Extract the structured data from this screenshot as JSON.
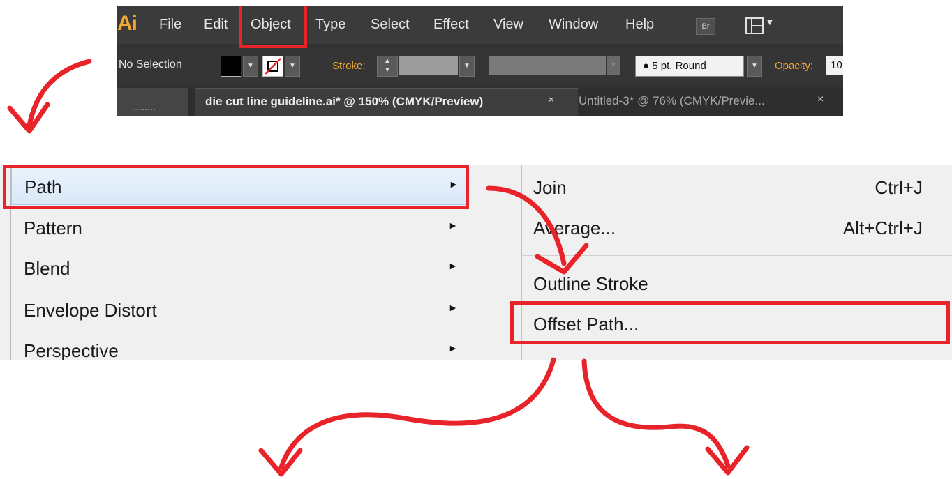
{
  "app": {
    "logo": "Ai",
    "menu": [
      "File",
      "Edit",
      "Object",
      "Type",
      "Select",
      "Effect",
      "View",
      "Window",
      "Help"
    ],
    "bridge_icon_label": "Br"
  },
  "control_bar": {
    "selection_status": "No Selection",
    "stroke_label": "Stroke:",
    "brush_value": "●  5 pt. Round",
    "opacity_label": "Opacity:",
    "opacity_value": "10"
  },
  "tabs": [
    {
      "title": "die cut line guideline.ai* @ 150% (CMYK/Preview)",
      "close": "×"
    },
    {
      "title": "Untitled-3* @ 76% (CMYK/Previe...",
      "close": "×"
    }
  ],
  "object_menu": {
    "items": [
      {
        "label": "Path",
        "submenu_marker": "►"
      },
      {
        "label": "Pattern",
        "submenu_marker": "►"
      },
      {
        "label": "Blend",
        "submenu_marker": "►"
      },
      {
        "label": "Envelope Distort",
        "submenu_marker": "►"
      },
      {
        "label": "Perspective",
        "submenu_marker": "►"
      }
    ]
  },
  "path_submenu": {
    "items": [
      {
        "label": "Join",
        "shortcut": "Ctrl+J"
      },
      {
        "label": "Average...",
        "shortcut": "Alt+Ctrl+J"
      },
      {
        "label": "Outline Stroke",
        "shortcut": ""
      },
      {
        "label": "Offset Path...",
        "shortcut": ""
      }
    ]
  },
  "colors": {
    "highlight": "#e8232a",
    "ui_dark": "#3b3b3b",
    "accent_orange": "#f0a830",
    "menu_bg": "#f0f0f0",
    "selected_item": "#dce9f8"
  }
}
